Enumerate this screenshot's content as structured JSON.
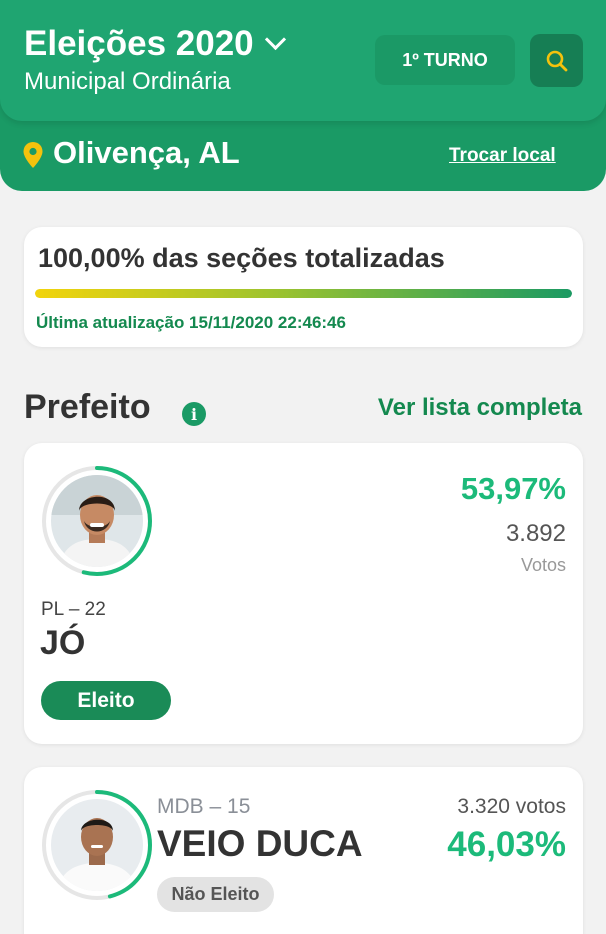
{
  "header": {
    "title": "Eleições 2020",
    "subtitle": "Municipal Ordinária",
    "turno_label": "1º TURNO",
    "location": "Olivença, AL",
    "change_location_label": "Trocar local"
  },
  "totalization": {
    "label": "100,00% das seções totalizadas",
    "percent": 100.0,
    "last_update": "Última atualização 15/11/2020 22:46:46"
  },
  "section": {
    "title": "Prefeito",
    "full_list_label": "Ver lista completa"
  },
  "candidates": [
    {
      "party": "PL – 22",
      "name": "JÓ",
      "status": "Eleito",
      "percent_label": "53,97%",
      "percent": 53.97,
      "votes": "3.892",
      "votes_label": "Votos"
    },
    {
      "party": "MDB – 15",
      "name": "VEIO DUCA",
      "status": "Não Eleito",
      "percent_label": "46,03%",
      "percent": 46.03,
      "votes": "3.320 votos"
    }
  ],
  "colors": {
    "header_green": "#1fa571",
    "location_green": "#1a9a65",
    "accent_yellow": "#f4c20d",
    "percent_green": "#1cba7a",
    "elected_badge": "#1a8b57"
  },
  "icons": {
    "dropdown": "chevron-down-icon",
    "search": "search-icon",
    "location": "map-pin-icon",
    "info": "info-icon"
  }
}
